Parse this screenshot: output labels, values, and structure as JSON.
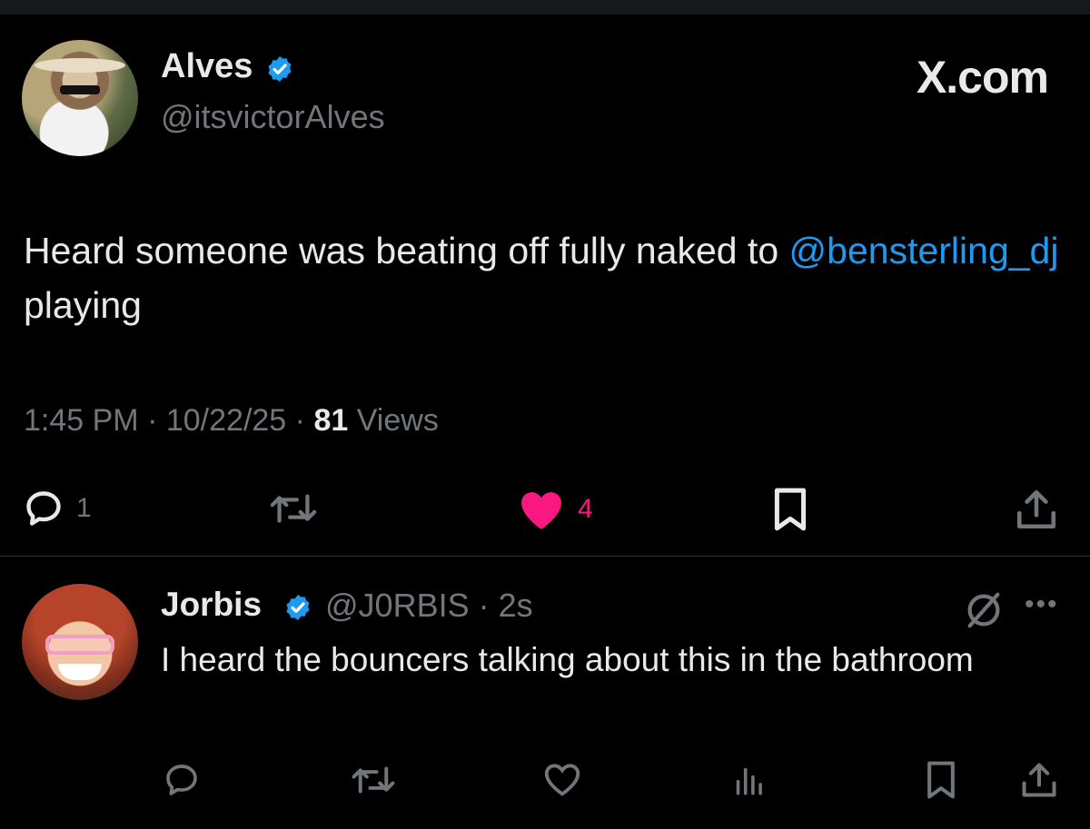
{
  "post": {
    "author_name": "Alves",
    "author_handle": "@itsvictorAlves",
    "source_label": "X.com",
    "text_before": "Heard someone was beating off fully naked to ",
    "mention": "@bensterling_dj",
    "text_after": " playing",
    "time": "1:45 PM",
    "date": "10/22/25",
    "views_count": "81",
    "views_label": "Views",
    "separator": "·",
    "reply_count": "1",
    "like_count": "4",
    "like_color": "#f91880"
  },
  "reply": {
    "author_name": "Jorbis",
    "author_handle": "@J0RBIS",
    "age": "2s",
    "separator": "·",
    "text": "I heard the bouncers talking about this in the bathroom"
  },
  "colors": {
    "background": "#000000",
    "text": "#e7e9ea",
    "muted": "#71767b",
    "link": "#1d9bf0",
    "verified": "#1d9bf0"
  },
  "icons": {
    "verified": "verified-badge-icon",
    "reply": "reply-bubble-icon",
    "repost": "repost-arrows-icon",
    "like": "heart-icon",
    "bookmark": "bookmark-icon",
    "share": "share-upload-icon",
    "views": "bar-chart-icon",
    "grok": "grok-slash-icon",
    "more": "more-dots-icon"
  }
}
